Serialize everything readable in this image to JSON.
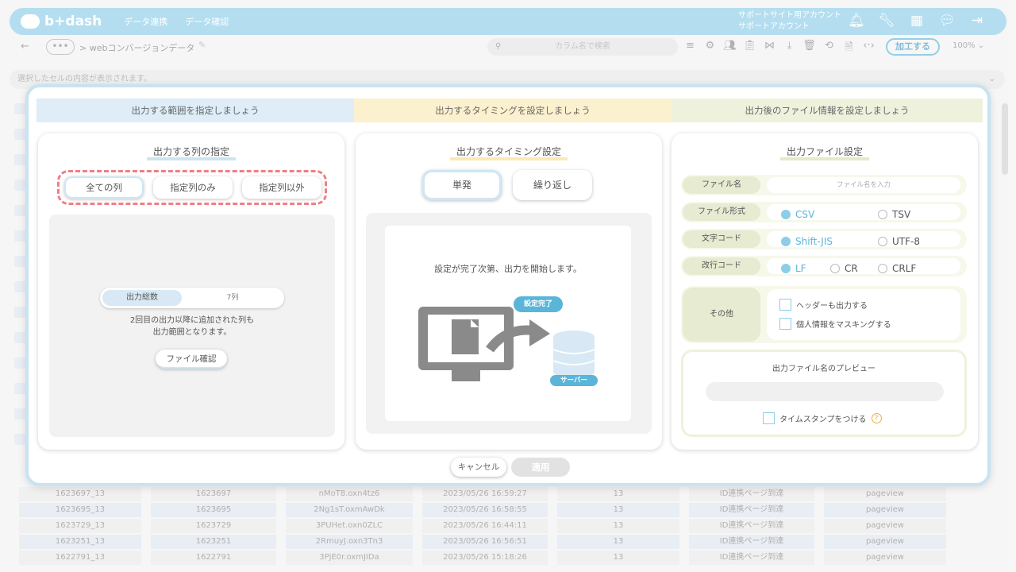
{
  "app": {
    "logo": "b+dash",
    "nav": [
      "データ連携",
      "データ確認"
    ],
    "account_line1": "サポートサイト用アカウント",
    "account_line2": "サポートアカウント"
  },
  "toolbar": {
    "more": "•••",
    "breadcrumb": "> webコンバージョンデータ",
    "search_placeholder": "カラム名で検索",
    "process_label": "加工する",
    "zoom": "100%"
  },
  "cellbar": {
    "text": "選択したセルの内容が表示されます。"
  },
  "steps": [
    "出力する範囲を指定しましょう",
    "出力するタイミングを設定しましょう",
    "出力後のファイル情報を設定しましょう"
  ],
  "panel_columns": {
    "title": "出力する列の指定",
    "options": [
      "全ての列",
      "指定列のみ",
      "指定列以外"
    ],
    "total_label": "出力総数",
    "total_value": "7列",
    "note_line1": "2回目の出力以降に追加された列も",
    "note_line2": "出力範囲となります。",
    "file_check": "ファイル確認"
  },
  "panel_timing": {
    "title": "出力するタイミング設定",
    "options": [
      "単発",
      "繰り返し"
    ],
    "message": "設定が完了次第、出力を開始します。",
    "done_tag": "設定完了",
    "server_tag": "サーバー"
  },
  "panel_file": {
    "title": "出力ファイル設定",
    "filename_label": "ファイル名",
    "filename_placeholder": "ファイル名を入力",
    "format_label": "ファイル形式",
    "format_options": [
      "CSV",
      "TSV"
    ],
    "encoding_label": "文字コード",
    "encoding_options": [
      "Shift-JIS",
      "UTF-8"
    ],
    "newline_label": "改行コード",
    "newline_options": [
      "LF",
      "CR",
      "CRLF"
    ],
    "other_label": "その他",
    "other_options": [
      "ヘッダーも出力する",
      "個人情報をマスキングする"
    ],
    "preview_label": "出力ファイル名のプレビュー",
    "timestamp_label": "タイムスタンプをつける",
    "help": "?"
  },
  "footer": {
    "cancel": "キャンセル",
    "apply": "適用"
  },
  "table_rows": [
    [
      "1623697_13",
      "1623697",
      "nMoT8.oxn4tz6",
      "2023/05/26 16:59:27",
      "13",
      "ID連携ページ到達",
      "pageview"
    ],
    [
      "1623695_13",
      "1623695",
      "2Ng1sT.oxmAwDk",
      "2023/05/26 16:58:55",
      "13",
      "ID連携ページ到達",
      "pageview"
    ],
    [
      "1623729_13",
      "1623729",
      "3PUHet.oxn0ZLC",
      "2023/05/26 16:44:11",
      "13",
      "ID連携ページ到達",
      "pageview"
    ],
    [
      "1623251_13",
      "1623251",
      "2RmuyJ.oxn3Tn3",
      "2023/05/26 16:56:51",
      "13",
      "ID連携ページ到達",
      "pageview"
    ],
    [
      "1622791_13",
      "1622791",
      "3PjE0r.oxmJIDa",
      "2023/05/26 15:18:26",
      "13",
      "ID連携ページ到達",
      "pageview"
    ]
  ],
  "colors": {
    "accent": "#5ab5d8",
    "header": "#8ccde8",
    "dashed": "#f07f86"
  }
}
